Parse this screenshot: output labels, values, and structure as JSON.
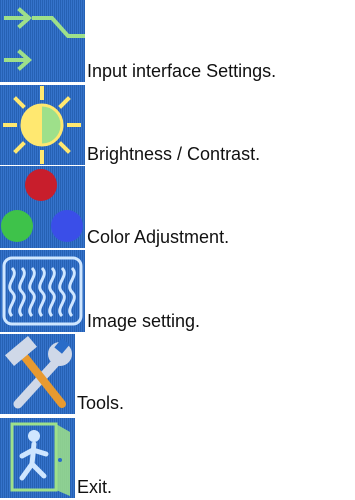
{
  "menu": {
    "items": [
      {
        "icon": "input-arrows-icon",
        "label": "Input interface Settings."
      },
      {
        "icon": "brightness-sun-icon",
        "label": "Brightness / Contrast."
      },
      {
        "icon": "color-dots-icon",
        "label": "Color Adjustment."
      },
      {
        "icon": "image-waves-icon",
        "label": "Image setting."
      },
      {
        "icon": "tools-icon",
        "label": "Tools."
      },
      {
        "icon": "exit-door-icon",
        "label": "Exit."
      }
    ]
  },
  "colors": {
    "tile_blue": "#2a6cc8",
    "icon_green": "#9ee08a",
    "sun_yellow": "#ffe870",
    "dot_red": "#c81e2c",
    "dot_green": "#3ec24a",
    "dot_blue": "#3a4ee8",
    "tool_silver": "#cfd8e8",
    "tool_orange": "#e89a30"
  }
}
